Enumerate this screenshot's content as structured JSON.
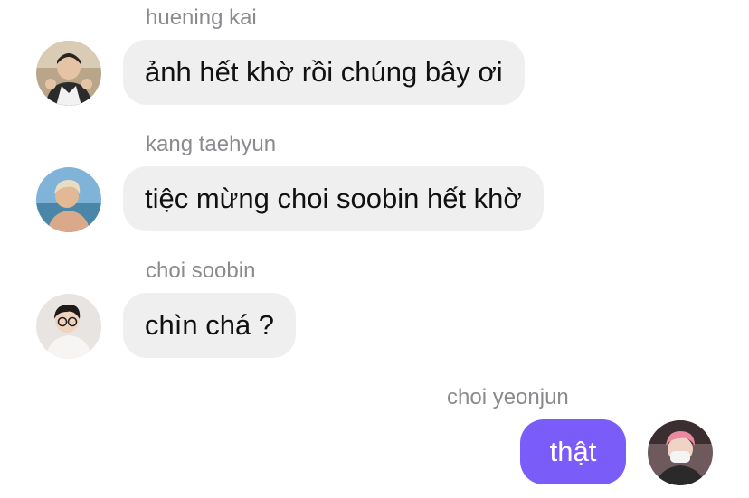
{
  "colors": {
    "incoming_bubble": "#efefef",
    "outgoing_bubble": "#7a5cf8",
    "sender_name": "#8a8a8f",
    "message_text": "#111111"
  },
  "messages": [
    {
      "sender": "huening kai",
      "text": "ảnh hết khờ rồi chúng bây ơi",
      "direction": "incoming",
      "avatar_icon": "user-avatar-photo"
    },
    {
      "sender": "kang taehyun",
      "text": "tiệc mừng choi soobin hết khờ",
      "direction": "incoming",
      "avatar_icon": "user-avatar-photo"
    },
    {
      "sender": "choi soobin",
      "text": "chìn chá ?",
      "direction": "incoming",
      "avatar_icon": "user-avatar-photo"
    },
    {
      "sender": "choi yeonjun",
      "text": "thật",
      "direction": "outgoing",
      "avatar_icon": "user-avatar-photo"
    }
  ]
}
